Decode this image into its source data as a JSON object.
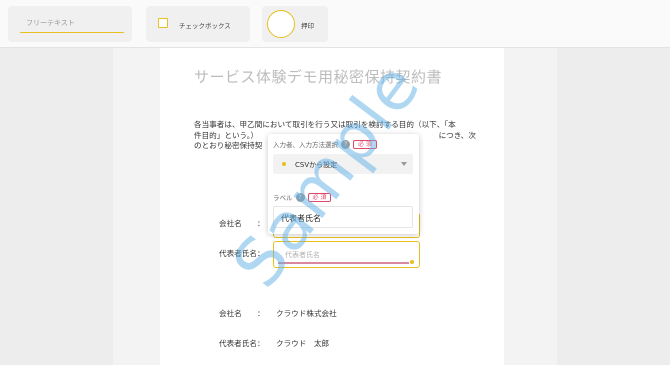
{
  "toolbar": {
    "free_text_placeholder": "フリーテキスト",
    "checkbox_label": "チェックボックス",
    "seal_label": "押印"
  },
  "document": {
    "title": "サービス体験デモ用秘密保持契約書",
    "body_line1": "各当事者は、甲乙間において取引を行う又は取引を検討する目的（以下、「本",
    "body_line2": "件目的」という。）",
    "body_line2_tail": "につき、次",
    "body_line3": "のとおり秘密保持契",
    "company_label_1": "会社名　　：",
    "rep_label_1": "代表者氏名：",
    "company_label_2": "会社名　　：",
    "company_value_2": "クラウド株式会社",
    "rep_label_2": "代表者氏名：",
    "rep_value_2": "クラウド　太郎"
  },
  "active_field": {
    "placeholder": "代表者氏名"
  },
  "popup": {
    "input_method_label": "入力者、入力方法選択",
    "help_mark": "?",
    "required_badge": "必 須",
    "select_value": "CSVから設定",
    "label_title": "ラベル",
    "label_value": "代表者氏名"
  },
  "watermark": "Sample",
  "colors": {
    "accent_yellow": "#e8c020",
    "required_red": "#e04a6a",
    "watermark_blue": "#5fafe6"
  }
}
